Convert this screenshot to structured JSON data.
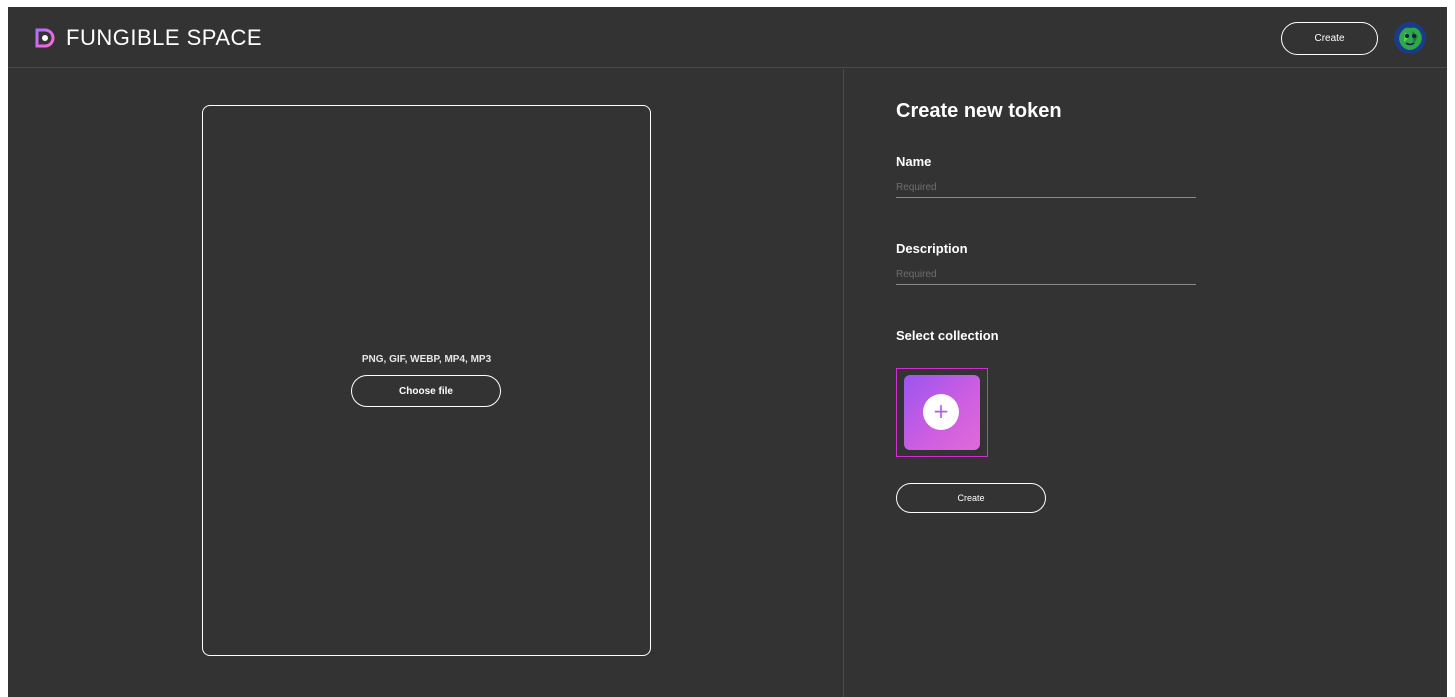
{
  "header": {
    "logo_text": "FUNGIBLE SPACE",
    "logo_icon": "fungible-logo-icon",
    "create_label": "Create",
    "avatar_icon": "avatar"
  },
  "upload": {
    "formats": "PNG, GIF, WEBP, MP4, MP3",
    "choose_label": "Choose file"
  },
  "form": {
    "title": "Create new token",
    "name_label": "Name",
    "name_placeholder": "Required",
    "name_value": "",
    "description_label": "Description",
    "description_placeholder": "Required",
    "description_value": "",
    "collection_label": "Select collection",
    "add_collection_icon": "plus-icon",
    "add_collection_symbol": "+",
    "create_label": "Create"
  },
  "colors": {
    "background": "#333333",
    "accent_gradient_start": "#9a55f0",
    "accent_gradient_end": "#e06ad8",
    "selection_outline": "#d62cd6"
  }
}
